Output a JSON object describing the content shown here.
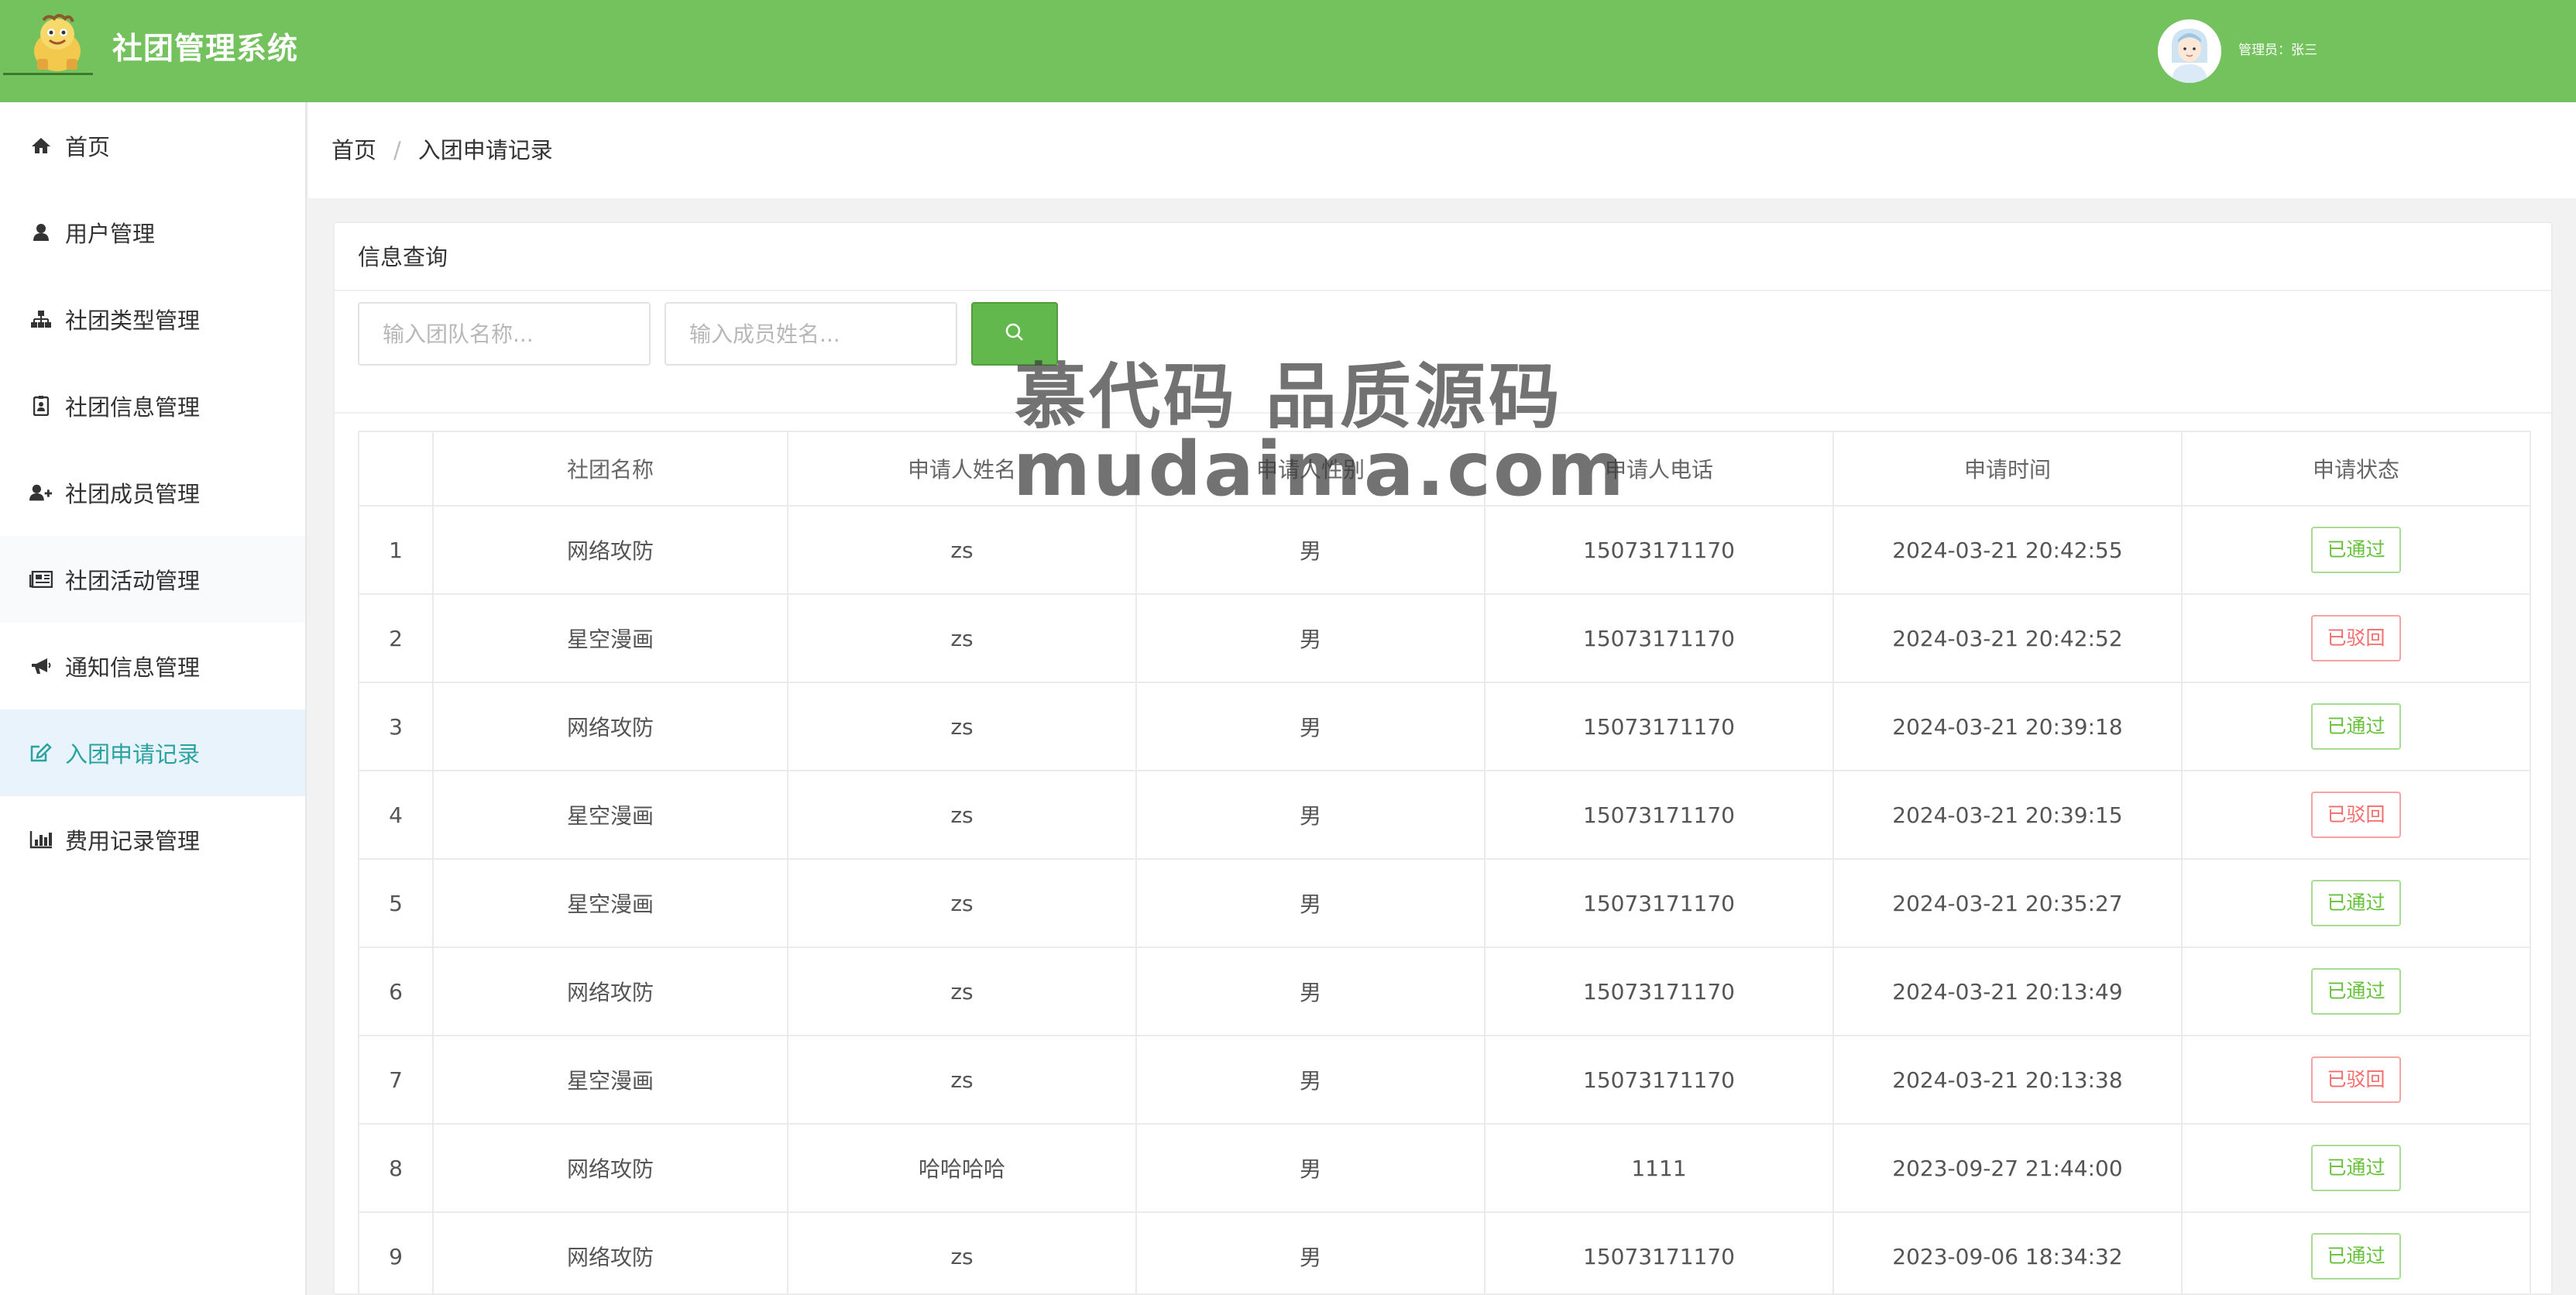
{
  "header": {
    "app_title": "社团管理系统",
    "admin_label": "管理员：张三"
  },
  "sidebar": {
    "items": [
      {
        "label": "首页",
        "icon": "home-icon"
      },
      {
        "label": "用户管理",
        "icon": "user-icon"
      },
      {
        "label": "社团类型管理",
        "icon": "sitemap-icon"
      },
      {
        "label": "社团信息管理",
        "icon": "id-card-icon"
      },
      {
        "label": "社团成员管理",
        "icon": "user-plus-icon"
      },
      {
        "label": "社团活动管理",
        "icon": "newspaper-icon"
      },
      {
        "label": "通知信息管理",
        "icon": "bullhorn-icon"
      },
      {
        "label": "入团申请记录",
        "icon": "edit-icon"
      },
      {
        "label": "费用记录管理",
        "icon": "bar-chart-icon"
      }
    ],
    "active_index": 7
  },
  "breadcrumb": {
    "home": "首页",
    "separator": "/",
    "current": "入团申请记录"
  },
  "query": {
    "title": "信息查询",
    "team_placeholder": "输入团队名称...",
    "member_placeholder": "输入成员姓名..."
  },
  "table": {
    "headers": [
      "",
      "社团名称",
      "申请人姓名",
      "申请人性别",
      "申请人电话",
      "申请时间",
      "申请状态"
    ],
    "rows": [
      {
        "no": "1",
        "club": "网络攻防",
        "name": "zs",
        "gender": "男",
        "phone": "15073171170",
        "time": "2024-03-21 20:42:55",
        "status": "已通过",
        "status_type": "pass"
      },
      {
        "no": "2",
        "club": "星空漫画",
        "name": "zs",
        "gender": "男",
        "phone": "15073171170",
        "time": "2024-03-21 20:42:52",
        "status": "已驳回",
        "status_type": "reject"
      },
      {
        "no": "3",
        "club": "网络攻防",
        "name": "zs",
        "gender": "男",
        "phone": "15073171170",
        "time": "2024-03-21 20:39:18",
        "status": "已通过",
        "status_type": "pass"
      },
      {
        "no": "4",
        "club": "星空漫画",
        "name": "zs",
        "gender": "男",
        "phone": "15073171170",
        "time": "2024-03-21 20:39:15",
        "status": "已驳回",
        "status_type": "reject"
      },
      {
        "no": "5",
        "club": "星空漫画",
        "name": "zs",
        "gender": "男",
        "phone": "15073171170",
        "time": "2024-03-21 20:35:27",
        "status": "已通过",
        "status_type": "pass"
      },
      {
        "no": "6",
        "club": "网络攻防",
        "name": "zs",
        "gender": "男",
        "phone": "15073171170",
        "time": "2024-03-21 20:13:49",
        "status": "已通过",
        "status_type": "pass"
      },
      {
        "no": "7",
        "club": "星空漫画",
        "name": "zs",
        "gender": "男",
        "phone": "15073171170",
        "time": "2024-03-21 20:13:38",
        "status": "已驳回",
        "status_type": "reject"
      },
      {
        "no": "8",
        "club": "网络攻防",
        "name": "哈哈哈哈",
        "gender": "男",
        "phone": "1111",
        "time": "2023-09-27 21:44:00",
        "status": "已通过",
        "status_type": "pass"
      },
      {
        "no": "9",
        "club": "网络攻防",
        "name": "zs",
        "gender": "男",
        "phone": "15073171170",
        "time": "2023-09-06 18:34:32",
        "status": "已通过",
        "status_type": "pass"
      }
    ]
  },
  "watermark": {
    "line1": "慕代码 品质源码",
    "line2": "mudaima.com"
  },
  "colors": {
    "header_bg": "#74c25e",
    "search_button": "#62b84d",
    "active_menu_bg": "#e8f3fb",
    "active_menu_text": "#2aa3a0",
    "status_pass": "#67c23a",
    "status_reject": "#f56c6c"
  }
}
